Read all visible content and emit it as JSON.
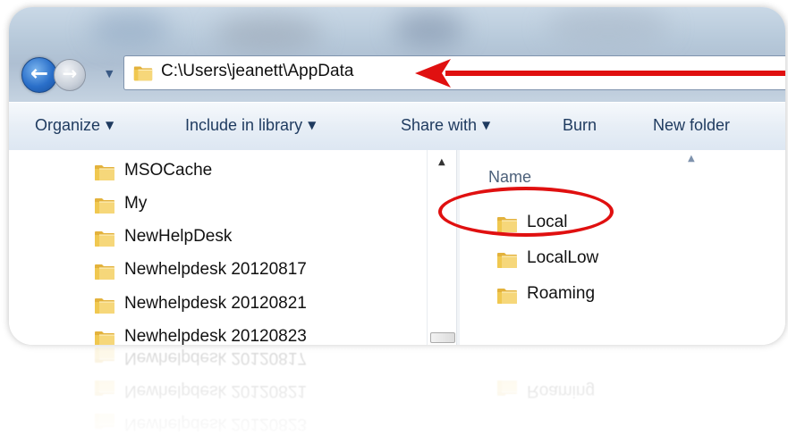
{
  "address_bar": {
    "path": "C:\\Users\\jeanett\\AppData",
    "folder_icon": "folder-icon"
  },
  "navigation": {
    "back_icon": "arrow-left-icon",
    "forward_icon": "arrow-right-icon",
    "history_icon": "chevron-down-icon"
  },
  "toolbar": {
    "items": [
      {
        "label": "Organize",
        "has_dropdown": true
      },
      {
        "label": "Include in library",
        "has_dropdown": true
      },
      {
        "label": "Share with",
        "has_dropdown": true
      },
      {
        "label": "Burn",
        "has_dropdown": false
      },
      {
        "label": "New folder",
        "has_dropdown": false
      }
    ]
  },
  "nav_pane": {
    "items": [
      {
        "label": "MSOCache"
      },
      {
        "label": "My"
      },
      {
        "label": "NewHelpDesk"
      },
      {
        "label": "Newhelpdesk 20120817"
      },
      {
        "label": "Newhelpdesk 20120821"
      },
      {
        "label": "Newhelpdesk 20120823"
      }
    ]
  },
  "file_list": {
    "column_header": "Name",
    "items": [
      {
        "label": "Local",
        "highlighted": true
      },
      {
        "label": "LocalLow",
        "highlighted": false
      },
      {
        "label": "Roaming",
        "highlighted": false
      }
    ]
  },
  "annotations": {
    "arrow_color": "#e01010",
    "circle_color": "#e01010"
  },
  "colors": {
    "toolbar_text": "#1e3a5f",
    "folder_yellow": "#f0c850"
  }
}
